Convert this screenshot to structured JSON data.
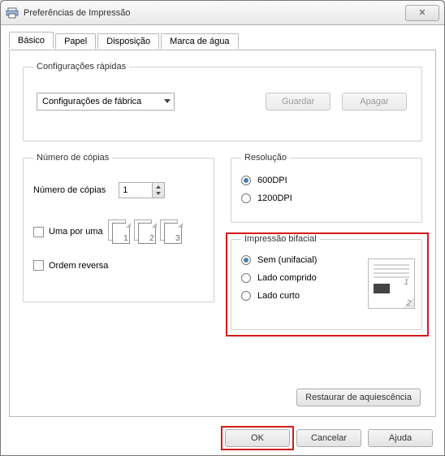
{
  "window_title": "Preferências de Impressão",
  "tabs": {
    "basic": "Básico",
    "paper": "Papel",
    "layout": "Disposição",
    "watermark": "Marca de água"
  },
  "quick": {
    "legend": "Configurações rápidas",
    "combo_value": "Configurações de fábrica",
    "save": "Guardar",
    "delete": "Apagar"
  },
  "copies": {
    "legend": "Número de cópias",
    "label": "Número de cópias",
    "value": "1",
    "collate": "Uma por uma",
    "reverse": "Ordem reversa",
    "page_nums": [
      "1",
      "2",
      "3"
    ]
  },
  "resolution": {
    "legend": "Resolução",
    "opt600": "600DPI",
    "opt1200": "1200DPI"
  },
  "duplex": {
    "legend": "Impressão bifacial",
    "none": "Sem (unifacial)",
    "long": "Lado comprido",
    "short": "Lado curto"
  },
  "restore": "Restaurar de aquiescência",
  "buttons": {
    "ok": "OK",
    "cancel": "Cancelar",
    "help": "Ajuda"
  }
}
